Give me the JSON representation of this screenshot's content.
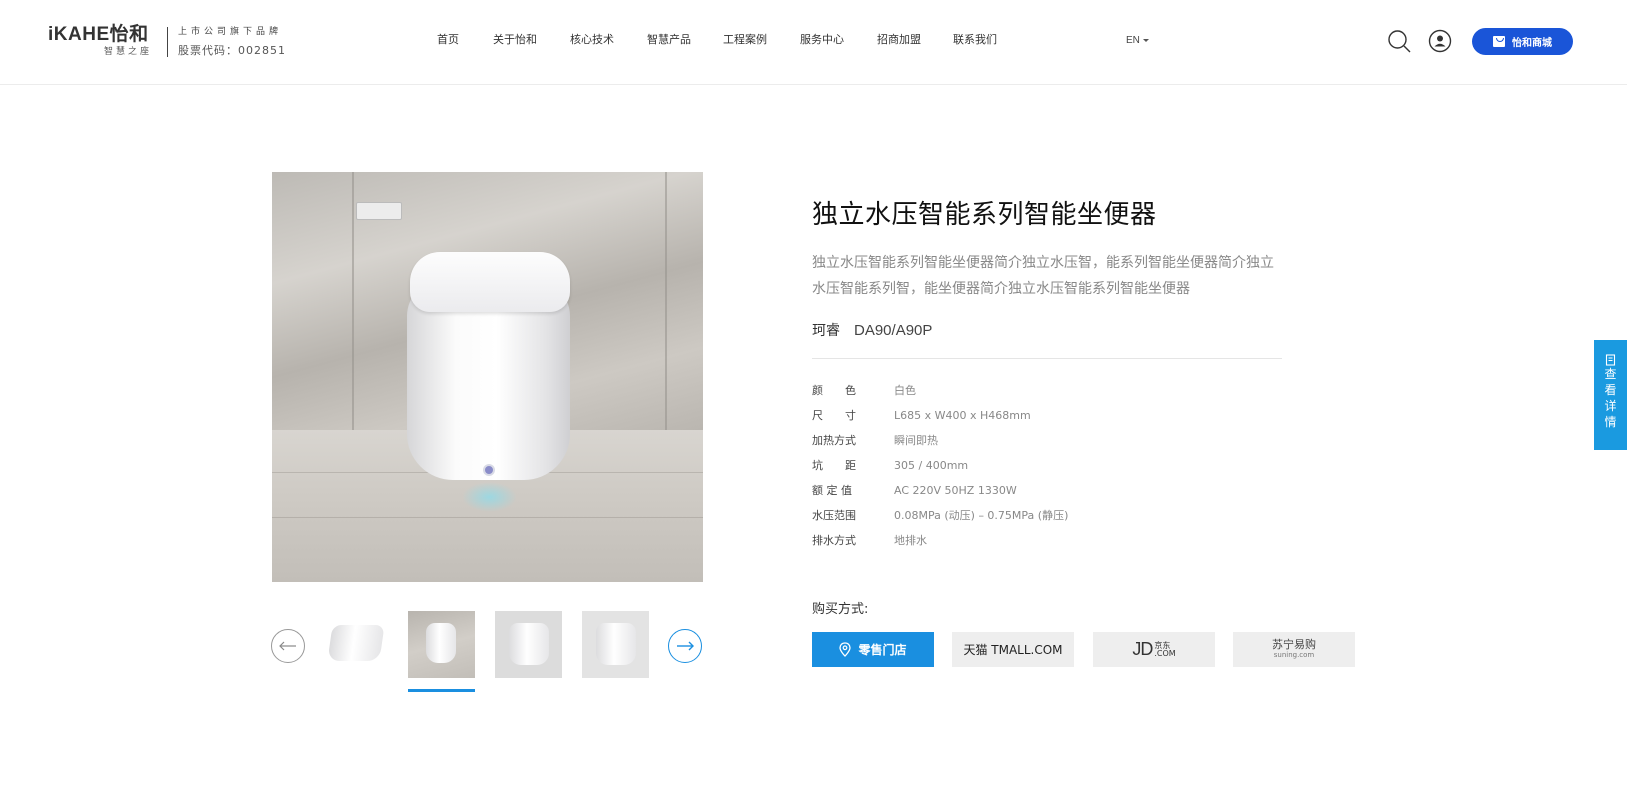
{
  "header": {
    "logo": {
      "brand": "iKAHE怡和",
      "tagline": "智慧之座"
    },
    "logo_info": {
      "line1": "上市公司旗下品牌",
      "line2": "股票代码：002851"
    },
    "nav": [
      {
        "label": "首页"
      },
      {
        "label": "关于怡和"
      },
      {
        "label": "核心技术"
      },
      {
        "label": "智慧产品"
      },
      {
        "label": "工程案例"
      },
      {
        "label": "服务中心"
      },
      {
        "label": "招商加盟"
      },
      {
        "label": "联系我们"
      }
    ],
    "lang": "EN",
    "shop_label": "怡和商城"
  },
  "product": {
    "title": "独立水压智能系列智能坐便器",
    "description": "独立水压智能系列智能坐便器简介独立水压智，能系列智能坐便器简介独立水压智能系列智，能坐便器简介独立水压智能系列智能坐便器",
    "series": "珂睿",
    "model": "DA90/A90P",
    "specs": [
      {
        "key": "颜　　色",
        "value": "白色"
      },
      {
        "key": "尺　　寸",
        "value": "L685 x W400 x H468mm"
      },
      {
        "key": "加热方式",
        "value": "瞬间即热"
      },
      {
        "key": "坑　　距",
        "value": "305 / 400mm"
      },
      {
        "key": "额 定 值",
        "value": "AC 220V 50HZ 1330W"
      },
      {
        "key": "水压范围",
        "value": "0.08MPa (动压) – 0.75MPa (静压)"
      },
      {
        "key": "排水方式",
        "value": "地排水"
      }
    ]
  },
  "gallery": {
    "active_index": 1,
    "thumb_count": 4
  },
  "buy": {
    "label": "购买方式:",
    "store": "零售门店",
    "tmall": "天猫 TMALL.COM",
    "jd": "JD",
    "jd_sub1": "京东",
    "jd_sub2": ".COM",
    "suning": "苏宁易购",
    "suning_sub": "suning.com"
  },
  "side_tab": {
    "chars": [
      "查",
      "看",
      "详",
      "情"
    ]
  },
  "colors": {
    "brand_blue": "#1a55d8",
    "accent_blue": "#1a8fe0"
  }
}
